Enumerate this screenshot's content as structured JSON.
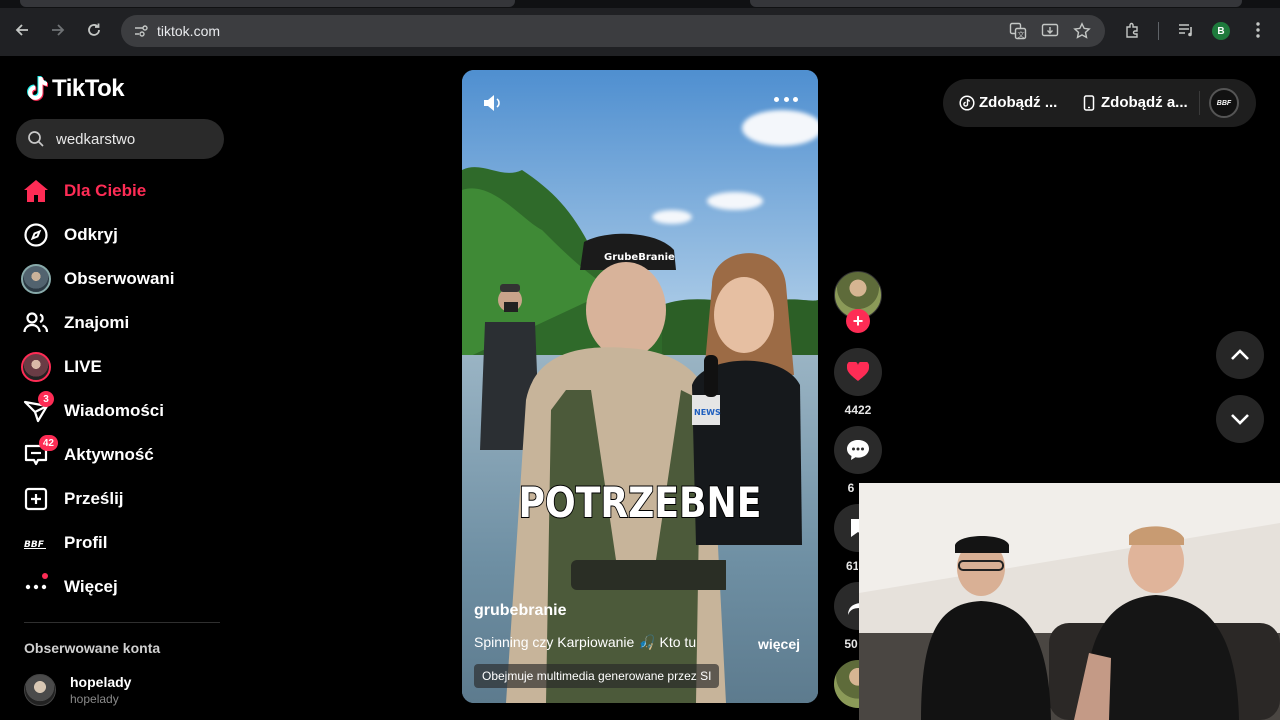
{
  "browser": {
    "url": "tiktok.com",
    "profile_initial": "B"
  },
  "tiktok": {
    "logo_text": "TikTok",
    "search": {
      "value": "wedkarstwo"
    },
    "nav": [
      {
        "label": "Dla Ciebie",
        "icon": "home-icon",
        "active": true
      },
      {
        "label": "Odkryj",
        "icon": "compass-icon"
      },
      {
        "label": "Obserwowani",
        "icon": "following-avatar-icon"
      },
      {
        "label": "Znajomi",
        "icon": "friends-icon"
      },
      {
        "label": "LIVE",
        "icon": "live-avatar-icon"
      },
      {
        "label": "Wiadomości",
        "icon": "messages-icon",
        "badge": "3"
      },
      {
        "label": "Aktywność",
        "icon": "activity-icon",
        "badge": "42"
      },
      {
        "label": "Prześlij",
        "icon": "upload-icon"
      },
      {
        "label": "Profil",
        "icon": "profile-logo-icon"
      },
      {
        "label": "Więcej",
        "icon": "more-icon"
      }
    ],
    "followed_title": "Obserwowane konta",
    "followed_accounts": [
      {
        "name": "hopelady",
        "username": "hopelady"
      }
    ],
    "top_pill": {
      "item1": "Zdobądź ...",
      "item2": "Zdobądź a...",
      "avatar_text": "BBF"
    }
  },
  "video": {
    "caption_overlay": "POTRZEBNE",
    "author": "grubebranie",
    "description": "Spinning czy Karpiowanie 🎣  Kto tu",
    "more_label": "więcej",
    "ai_label": "Obejmuje multimedia generowane przez SI",
    "cap_text": "GrubeBranie",
    "mic_text": "NEWS"
  },
  "actions": {
    "likes": "4422",
    "comments": "6",
    "saves": "61",
    "shares": "50"
  },
  "colors": {
    "accent": "#fe2c55",
    "sidebar_bg": "#000000",
    "chrome_bg": "#202124"
  }
}
